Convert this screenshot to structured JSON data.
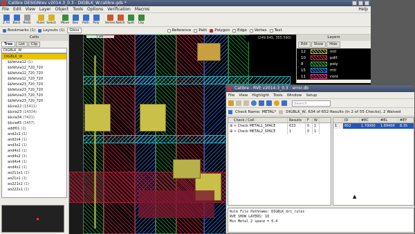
{
  "app": {
    "title": "Calibre DESIGNrev v2014.3_0.3 - DIGBLK_W.calibre.gds *"
  },
  "menu": [
    "File",
    "Edit",
    "View",
    "Layer",
    "Object",
    "Tools",
    "Options",
    "Verification",
    "Macros"
  ],
  "menu_help": "Help",
  "toolbar": [
    {
      "label": "Z All",
      "color": "#3a6ec8"
    },
    {
      "label": "Back",
      "color": "#3a6ec8"
    },
    {
      "label": "Redo",
      "color": "#9a9a9a"
    },
    {
      "label": "Ruler",
      "color": "#d8b020"
    },
    {
      "label": "Select",
      "color": "#d8b020"
    },
    {
      "label": "Move",
      "color": "#3a8a3a"
    },
    {
      "label": "Box",
      "color": "#3a6ec8"
    },
    {
      "label": "Path",
      "color": "#3a6ec8"
    },
    {
      "label": "Poly",
      "color": "#3a6ec8"
    },
    {
      "label": "Vertex",
      "color": "#c85a2a"
    },
    {
      "label": "Notch",
      "color": "#c85a2a"
    },
    {
      "label": "Split",
      "color": "#3a8a3a"
    },
    {
      "label": "Clip",
      "color": "#3a8a3a"
    }
  ],
  "toolbar2": {
    "bookmarks": "Bookmarks (1)",
    "layouts": "Layouts (1)",
    "gbox": "Gbox",
    "reference": "Reference",
    "path": "Path",
    "polygon": "Polygon",
    "edge": "Edge",
    "vertex": "Vertex",
    "text": "Text"
  },
  "cells": {
    "header": "Cells",
    "tabs": [
      "Tree",
      "List",
      "Clip"
    ],
    "top": "DIGBLK_W",
    "items": [
      {
        "name": "DIGBLK_W",
        "count": ""
      },
      {
        "name": "$$fetvia12",
        "count": "(1)"
      },
      {
        "name": "$$fetvia12_720_720",
        "count": ""
      },
      {
        "name": "$$fetvia12_720_720",
        "count": ""
      },
      {
        "name": "$$fetvia12_720_720",
        "count": ""
      },
      {
        "name": "$$fetvia23_720_720",
        "count": ""
      },
      {
        "name": "$$fetvia23_720_720",
        "count": ""
      },
      {
        "name": "$$fetvia23_720_720",
        "count": ""
      },
      {
        "name": "$$fetvia23_720_720",
        "count": ""
      },
      {
        "name": "$$via12",
        "count": "(15411)"
      },
      {
        "name": "$$via23",
        "count": "(14334)"
      },
      {
        "name": "$$via34",
        "count": "(7421)"
      },
      {
        "name": "$$via45",
        "count": "(1457)"
      },
      {
        "name": "addf01",
        "count": "(1)"
      },
      {
        "name": "and2x1",
        "count": "(1)"
      },
      {
        "name": "and2x4",
        "count": "(1)"
      },
      {
        "name": "and3x2",
        "count": "(1)"
      },
      {
        "name": "and4x1",
        "count": "(1)"
      },
      {
        "name": "and4x2",
        "count": "(1)"
      },
      {
        "name": "and4x4",
        "count": "(1)"
      },
      {
        "name": "and4x1",
        "count": "(1)"
      },
      {
        "name": "ao211x1",
        "count": "(1)"
      },
      {
        "name": "ao21x1",
        "count": "(1)"
      },
      {
        "name": "ao221x1",
        "count": "(1)"
      },
      {
        "name": "ao222x1",
        "count": "(1)"
      }
    ]
  },
  "canvas": {
    "coords": "(249.845, 355.590)",
    "scale_label": "1 um"
  },
  "layers": {
    "header": "Layers",
    "tabs": [
      "Edit",
      "Show",
      "Hide"
    ],
    "rows": [
      {
        "num": "12",
        "name": "mtl",
        "color": "#c8c020"
      },
      {
        "num": "10",
        "name": "pdif",
        "color": "#c82848"
      },
      {
        "num": "8",
        "name": "poly",
        "color": "#2ab04a"
      },
      {
        "num": "15",
        "name": "mtl",
        "color": "#2a8ae0"
      },
      {
        "num": "11",
        "name": "cont",
        "color": "#d83c78"
      }
    ]
  },
  "rve": {
    "title": "Calibre - RVE v2014.3_0.3 : error.db",
    "menu": [
      "File",
      "View",
      "Highlight",
      "Tools",
      "Window",
      "Setup"
    ],
    "search_placeholder": "Search",
    "check_name": "Check Name: METAL*",
    "summary": "DIGBLK_W, 634 of 652 Results (in 2 of 55 Checks), 2 Waived",
    "headers": [
      "Check / Cell",
      "Results",
      "F",
      "W"
    ],
    "rows": [
      {
        "name": "Check METAL1_SPACE",
        "results": "633",
        "f": "0",
        "w": "1"
      },
      {
        "name": "Check METAL2_SPACE",
        "results": "1",
        "f": "0",
        "w": "1"
      }
    ],
    "detail_headers": [
      "ID",
      "#EC",
      "#EL",
      "#EY"
    ],
    "detail_row": [
      "652",
      "1.70000",
      "1.89400",
      "8.35"
    ],
    "detail_index": "1",
    "text_lines": [
      "Rule File Pathname: DIGBLK_drc_rules",
      "RVE SHOW LAYERS: 18",
      "Min Metal 2 space = 0.4"
    ]
  },
  "colors": {
    "accent": "#2456b8",
    "highlight": "#e8c400"
  }
}
